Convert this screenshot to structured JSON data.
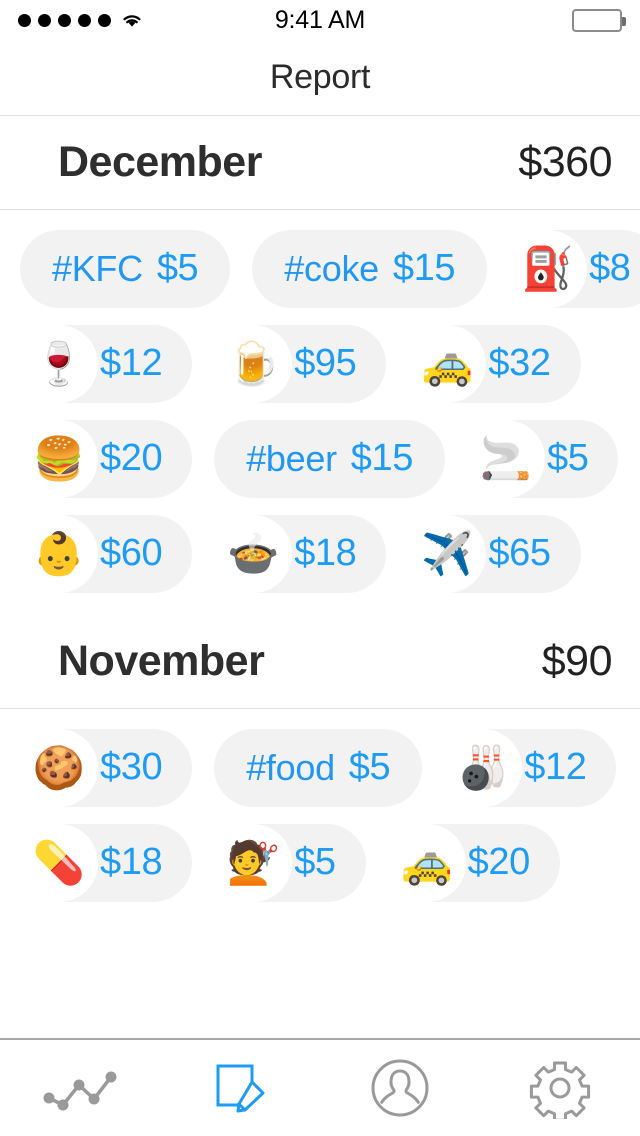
{
  "statusbar": {
    "signal_dots": 5,
    "wifi_icon": "wifi-icon",
    "time": "9:41 AM",
    "battery_icon": "battery-full-icon"
  },
  "navbar": {
    "title": "Report"
  },
  "colors": {
    "accent_blue": "#1e9bf3",
    "pill_background": "#f2f2f2",
    "emoji_circle": "#ffffff",
    "heading_text": "#2e2e2e",
    "tabbar_inactive": "#9a9a9a",
    "tabbar_active": "#1e9bf3",
    "separator": "#e3e3e5"
  },
  "sections": [
    {
      "month": "December",
      "total": "$360",
      "rows": [
        [
          {
            "type": "tag",
            "label": "#KFC",
            "amount": "$5",
            "icon": ""
          },
          {
            "type": "tag",
            "label": "#coke",
            "amount": "$15",
            "icon": ""
          },
          {
            "type": "emoji",
            "label": "",
            "amount": "$8",
            "icon": "⛽",
            "icon_name": "fuel-pump-emoji"
          }
        ],
        [
          {
            "type": "emoji",
            "label": "",
            "amount": "$12",
            "icon": "🍷",
            "icon_name": "wine-glass-emoji"
          },
          {
            "type": "emoji",
            "label": "",
            "amount": "$95",
            "icon": "🍺",
            "icon_name": "beer-mug-emoji"
          },
          {
            "type": "emoji",
            "label": "",
            "amount": "$32",
            "icon": "🚕",
            "icon_name": "taxi-emoji"
          }
        ],
        [
          {
            "type": "emoji",
            "label": "",
            "amount": "$20",
            "icon": "🍔",
            "icon_name": "hamburger-emoji"
          },
          {
            "type": "tag",
            "label": "#beer",
            "amount": "$15",
            "icon": ""
          },
          {
            "type": "emoji",
            "label": "",
            "amount": "$5",
            "icon": "🚬",
            "icon_name": "cigarette-emoji"
          }
        ],
        [
          {
            "type": "emoji",
            "label": "",
            "amount": "$60",
            "icon": "👶",
            "icon_name": "baby-emoji"
          },
          {
            "type": "emoji",
            "label": "",
            "amount": "$18",
            "icon": "🍲",
            "icon_name": "pot-of-food-emoji"
          },
          {
            "type": "emoji",
            "label": "",
            "amount": "$65",
            "icon": "✈️",
            "icon_name": "airplane-emoji"
          }
        ]
      ]
    },
    {
      "month": "November",
      "total": "$90",
      "rows": [
        [
          {
            "type": "emoji",
            "label": "",
            "amount": "$30",
            "icon": "🍪",
            "icon_name": "cookie-emoji"
          },
          {
            "type": "tag",
            "label": "#food",
            "amount": "$5",
            "icon": ""
          },
          {
            "type": "emoji",
            "label": "",
            "amount": "$12",
            "icon": "🎳",
            "icon_name": "bowling-emoji"
          }
        ],
        [
          {
            "type": "emoji",
            "label": "",
            "amount": "$18",
            "icon": "💊",
            "icon_name": "pill-emoji"
          },
          {
            "type": "emoji",
            "label": "",
            "amount": "$5",
            "icon": "💇",
            "icon_name": "haircut-emoji"
          },
          {
            "type": "emoji",
            "label": "",
            "amount": "$20",
            "icon": "🚕",
            "icon_name": "taxi-emoji"
          }
        ]
      ]
    }
  ],
  "tabbar": {
    "items": [
      {
        "icon_name": "line-chart-icon",
        "active": false
      },
      {
        "icon_name": "note-pencil-icon",
        "active": true
      },
      {
        "icon_name": "person-icon",
        "active": false
      },
      {
        "icon_name": "gear-icon",
        "active": false
      }
    ]
  }
}
